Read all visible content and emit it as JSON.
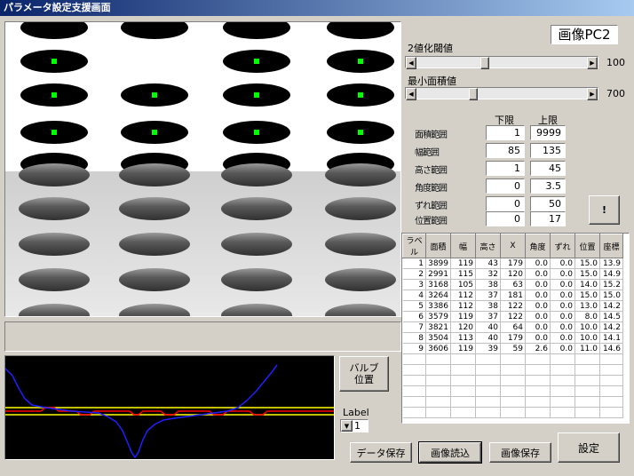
{
  "window": {
    "title": "パラメータ設定支援画面"
  },
  "camera_label": "画像PC2",
  "sliders": [
    {
      "label": "2値化閾値",
      "value": "100",
      "level": 0.39
    },
    {
      "label": "最小面積値",
      "value": "700",
      "level": 0.32
    }
  ],
  "limits": {
    "lower_header": "下限",
    "upper_header": "上限",
    "rows": [
      {
        "label": "面積範囲",
        "lower": "1",
        "upper": "9999"
      },
      {
        "label": "幅範囲",
        "lower": "85",
        "upper": "135"
      },
      {
        "label": "高さ範囲",
        "lower": "1",
        "upper": "45"
      },
      {
        "label": "角度範囲",
        "lower": "0",
        "upper": "3.5"
      },
      {
        "label": "ずれ範囲",
        "lower": "0",
        "upper": "50"
      },
      {
        "label": "位置範囲",
        "lower": "0",
        "upper": "17"
      }
    ],
    "apply_label": "!"
  },
  "results": {
    "headers": [
      "ラベル",
      "面積",
      "幅",
      "高さ",
      "X",
      "角度",
      "ずれ",
      "位置",
      "座標"
    ],
    "rows": [
      [
        "1",
        "3899",
        "119",
        "43",
        "179",
        "0.0",
        "0.0",
        "15.0",
        "13.9"
      ],
      [
        "2",
        "2991",
        "115",
        "32",
        "120",
        "0.0",
        "0.0",
        "15.0",
        "14.9"
      ],
      [
        "3",
        "3168",
        "105",
        "38",
        "63",
        "0.0",
        "0.0",
        "14.0",
        "15.2"
      ],
      [
        "4",
        "3264",
        "112",
        "37",
        "181",
        "0.0",
        "0.0",
        "15.0",
        "15.0"
      ],
      [
        "5",
        "3386",
        "112",
        "38",
        "122",
        "0.0",
        "0.0",
        "13.0",
        "14.2"
      ],
      [
        "6",
        "3579",
        "119",
        "37",
        "122",
        "0.0",
        "0.0",
        "8.0",
        "14.5"
      ],
      [
        "7",
        "3821",
        "120",
        "40",
        "64",
        "0.0",
        "0.0",
        "10.0",
        "14.2"
      ],
      [
        "8",
        "3504",
        "113",
        "40",
        "179",
        "0.0",
        "0.0",
        "10.0",
        "14.1"
      ],
      [
        "9",
        "3606",
        "119",
        "39",
        "59",
        "2.6",
        "0.0",
        "11.0",
        "14.6"
      ]
    ]
  },
  "valve_button": {
    "line1": "バルブ",
    "line2": "位置"
  },
  "label_select": {
    "caption": "Label",
    "value": "1"
  },
  "buttons": {
    "save_data": "データ保存",
    "load_image": "画像読込",
    "save_image": "画像保存",
    "settings": "設定"
  },
  "colors": {
    "titlebar_start": "#0a246a",
    "titlebar_end": "#a6caf0",
    "marker": "#00ff00",
    "waveform": "#2020ff",
    "threshold_line": "#ffff00",
    "detect_line": "#ff0000"
  }
}
